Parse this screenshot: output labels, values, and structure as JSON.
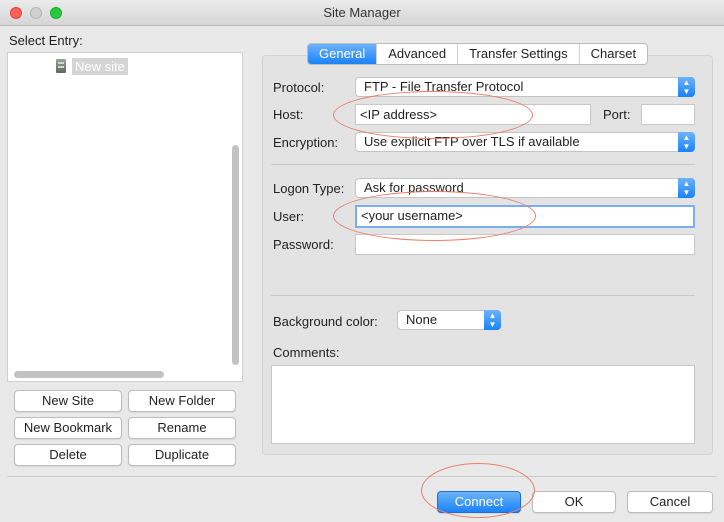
{
  "window": {
    "title": "Site Manager"
  },
  "left": {
    "select_entry_label": "Select Entry:",
    "tree": {
      "items": [
        {
          "label": "New site",
          "icon": "server-icon"
        }
      ]
    },
    "buttons": {
      "new_site": "New Site",
      "new_folder": "New Folder",
      "new_bookmark": "New Bookmark",
      "rename": "Rename",
      "delete": "Delete",
      "duplicate": "Duplicate"
    }
  },
  "tabs": [
    {
      "label": "General",
      "active": true
    },
    {
      "label": "Advanced",
      "active": false
    },
    {
      "label": "Transfer Settings",
      "active": false
    },
    {
      "label": "Charset",
      "active": false
    }
  ],
  "general": {
    "protocol": {
      "label": "Protocol:",
      "value": "FTP - File Transfer Protocol"
    },
    "host": {
      "label": "Host:",
      "value": "<IP address>"
    },
    "port": {
      "label": "Port:",
      "value": ""
    },
    "encryption": {
      "label": "Encryption:",
      "value": "Use explicit FTP over TLS if available"
    },
    "logon_type": {
      "label": "Logon Type:",
      "value": "Ask for password"
    },
    "user": {
      "label": "User:",
      "value": "<your username>"
    },
    "password": {
      "label": "Password:",
      "value": ""
    },
    "background_color": {
      "label": "Background color:",
      "value": "None"
    },
    "comments": {
      "label": "Comments:",
      "value": ""
    }
  },
  "footer": {
    "connect": "Connect",
    "ok": "OK",
    "cancel": "Cancel"
  },
  "colors": {
    "accent": "#1a82fb",
    "annotation": "#e8806a"
  }
}
